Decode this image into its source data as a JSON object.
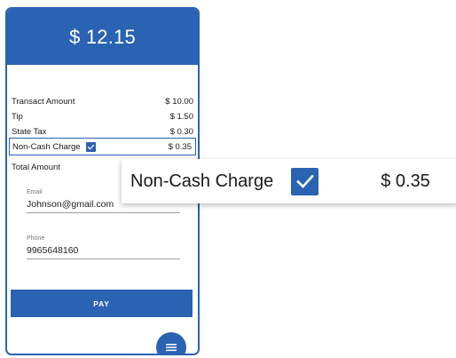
{
  "header": {
    "amount": "$ 12.15"
  },
  "lines": {
    "transact": {
      "label": "Transact Amount",
      "value": "$ 10.00"
    },
    "tip": {
      "label": "Tip",
      "value": "$ 1.50"
    },
    "tax": {
      "label": "State Tax",
      "value": "$ 0.30"
    },
    "noncash": {
      "label": "Non-Cash Charge",
      "value": "$ 0.35",
      "checked": true
    },
    "total": {
      "label": "Total Amount"
    }
  },
  "email": {
    "label": "Email",
    "value": "Johnson@gmail.com"
  },
  "phone": {
    "label": "Phone",
    "value": "9965648160"
  },
  "pay_button": {
    "label": "PAY"
  },
  "fab": {
    "icon": "menu-icon"
  },
  "zoom": {
    "label": "Non-Cash Charge",
    "value": "$ 0.35",
    "checked": true
  },
  "colors": {
    "primary": "#2a63b2",
    "text": "#1a1a1a"
  }
}
